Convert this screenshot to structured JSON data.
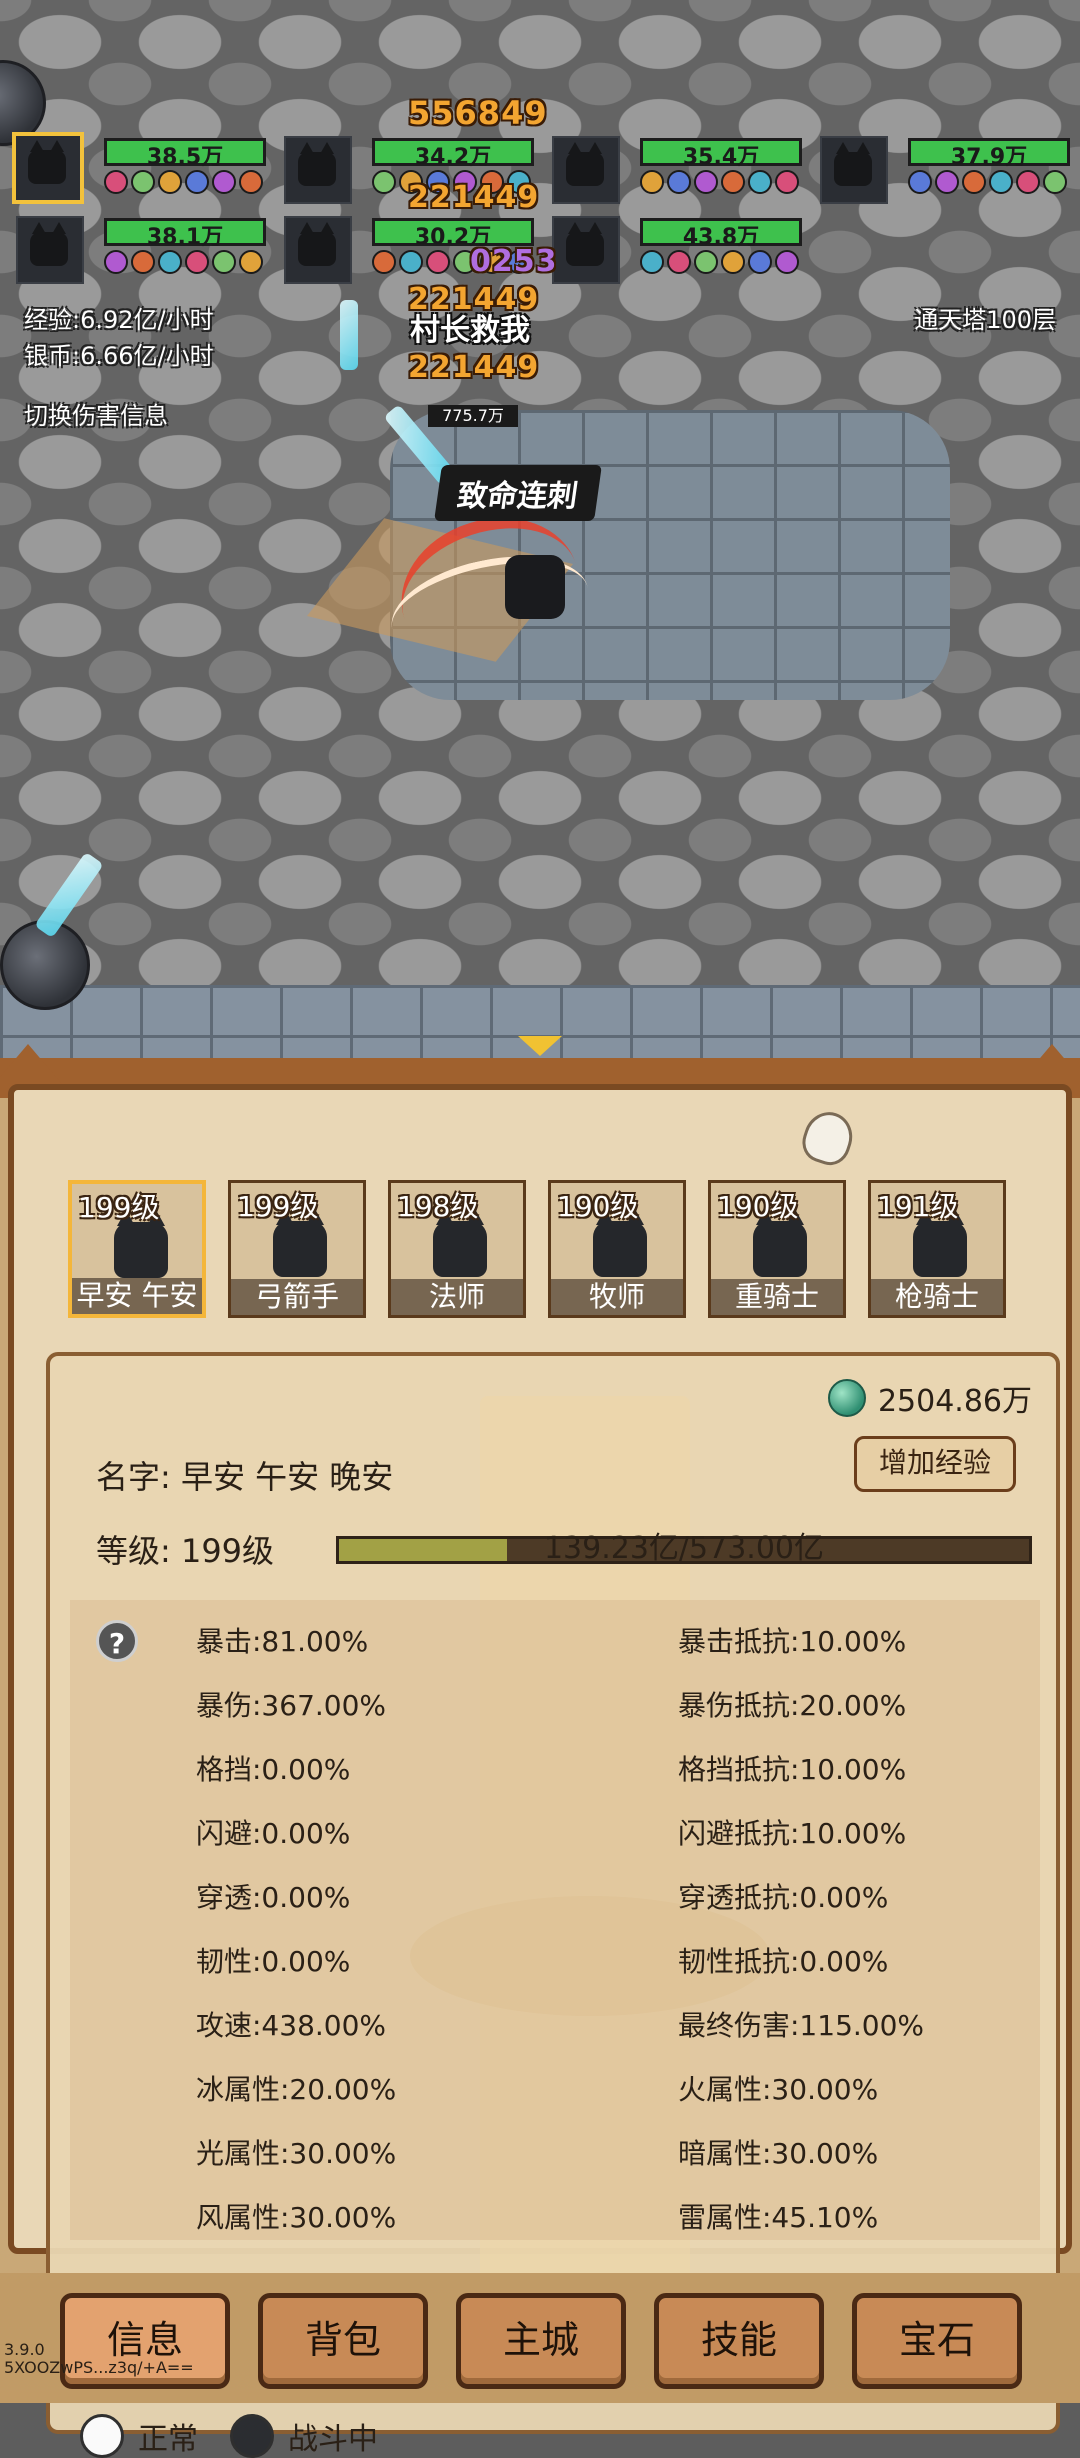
{
  "team": [
    {
      "hp": "38.5万",
      "selected": true
    },
    {
      "hp": "34.2万",
      "selected": false
    },
    {
      "hp": "35.4万",
      "selected": false
    },
    {
      "hp": "37.9万",
      "selected": false
    },
    {
      "hp": "38.1万",
      "selected": false
    },
    {
      "hp": "30.2万",
      "selected": false
    },
    {
      "hp": "43.8万",
      "selected": false
    }
  ],
  "battle": {
    "exp_rate": "经验:6.92亿/小时",
    "silver_rate": "银币:6.66亿/小时",
    "toggle_damage": "切换伤害信息",
    "tower": "通天塔100层",
    "boss_name": "村长救我",
    "boss_hp": "775.7万",
    "skill_banner": "致命连刺",
    "damage_numbers": [
      "556849",
      "221449",
      "221449",
      "221449",
      "0253"
    ]
  },
  "heroes": [
    {
      "level": "199级",
      "class": "早安 午安",
      "selected": true
    },
    {
      "level": "199级",
      "class": "弓箭手",
      "selected": false
    },
    {
      "level": "198级",
      "class": "法师",
      "selected": false
    },
    {
      "level": "190级",
      "class": "牧师",
      "selected": false
    },
    {
      "level": "190级",
      "class": "重骑士",
      "selected": false
    },
    {
      "level": "191级",
      "class": "枪骑士",
      "selected": false
    }
  ],
  "info": {
    "gems": "2504.86万",
    "add_exp": "增加经验",
    "name": "名字: 早安 午安 晚安",
    "level": "等级: 199级",
    "exp_text": "139.23亿/573.00亿",
    "exp_fraction": 0.243
  },
  "stats_left": [
    "暴击:81.00%",
    "暴伤:367.00%",
    "格挡:0.00%",
    "闪避:0.00%",
    "穿透:0.00%",
    "韧性:0.00%",
    "攻速:438.00%",
    "冰属性:20.00%",
    "光属性:30.00%",
    "风属性:30.00%"
  ],
  "stats_right": [
    "暴击抵抗:10.00%",
    "暴伤抵抗:20.00%",
    "格挡抵抗:10.00%",
    "闪避抵抗:10.00%",
    "穿透抵抗:0.00%",
    "韧性抵抗:0.00%",
    "最终伤害:115.00%",
    "火属性:30.00%",
    "暗属性:30.00%",
    "雷属性:45.10%"
  ],
  "status": {
    "normal": "正常",
    "in_battle": "战斗中"
  },
  "nav": [
    "信息",
    "背包",
    "主城",
    "技能",
    "宝石"
  ],
  "version": {
    "number": "3.9.0",
    "code": "5XOOZwPS...z3q/+A=="
  },
  "colors": {
    "hp_green": "#3ec14d",
    "selection_gold": "#f4b63a",
    "frame_brown": "#7a4a22",
    "gem_green": "#2f8f72"
  }
}
